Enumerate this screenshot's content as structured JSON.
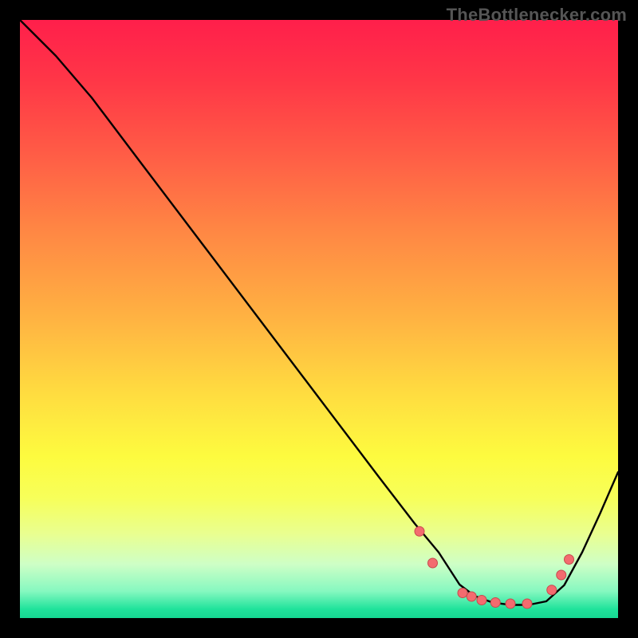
{
  "watermark": "TheBottlenecker.com",
  "colors": {
    "frame": "#000000",
    "curve": "#000000",
    "marker_fill": "#f36b6f",
    "marker_stroke": "#c84a4e",
    "gradient_stops": [
      {
        "offset": 0.0,
        "color": "#ff1f4b"
      },
      {
        "offset": 0.1,
        "color": "#ff3647"
      },
      {
        "offset": 0.22,
        "color": "#ff5b46"
      },
      {
        "offset": 0.35,
        "color": "#ff8644"
      },
      {
        "offset": 0.5,
        "color": "#ffb342"
      },
      {
        "offset": 0.63,
        "color": "#ffde40"
      },
      {
        "offset": 0.73,
        "color": "#fdfb3f"
      },
      {
        "offset": 0.8,
        "color": "#f7ff5a"
      },
      {
        "offset": 0.86,
        "color": "#e9ff91"
      },
      {
        "offset": 0.91,
        "color": "#ceffc6"
      },
      {
        "offset": 0.955,
        "color": "#86f8c0"
      },
      {
        "offset": 0.985,
        "color": "#20e39b"
      },
      {
        "offset": 1.0,
        "color": "#16d892"
      }
    ]
  },
  "chart_data": {
    "type": "line",
    "title": "",
    "xlabel": "",
    "ylabel": "",
    "xlim": [
      0,
      1
    ],
    "ylim": [
      0,
      1
    ],
    "series": [
      {
        "name": "bottleneck-curve",
        "x": [
          0.0,
          0.06,
          0.12,
          0.2,
          0.3,
          0.4,
          0.5,
          0.6,
          0.66,
          0.7,
          0.735,
          0.76,
          0.79,
          0.82,
          0.85,
          0.88,
          0.91,
          0.94,
          0.97,
          1.0
        ],
        "y": [
          1.0,
          0.94,
          0.87,
          0.764,
          0.632,
          0.5,
          0.368,
          0.236,
          0.158,
          0.11,
          0.056,
          0.037,
          0.026,
          0.022,
          0.022,
          0.028,
          0.055,
          0.11,
          0.175,
          0.244
        ]
      }
    ],
    "markers": {
      "name": "highlight-band",
      "x": [
        0.668,
        0.69,
        0.74,
        0.755,
        0.772,
        0.795,
        0.82,
        0.848,
        0.889,
        0.905,
        0.918
      ],
      "y": [
        0.145,
        0.092,
        0.042,
        0.036,
        0.03,
        0.026,
        0.024,
        0.024,
        0.047,
        0.072,
        0.098
      ]
    }
  }
}
